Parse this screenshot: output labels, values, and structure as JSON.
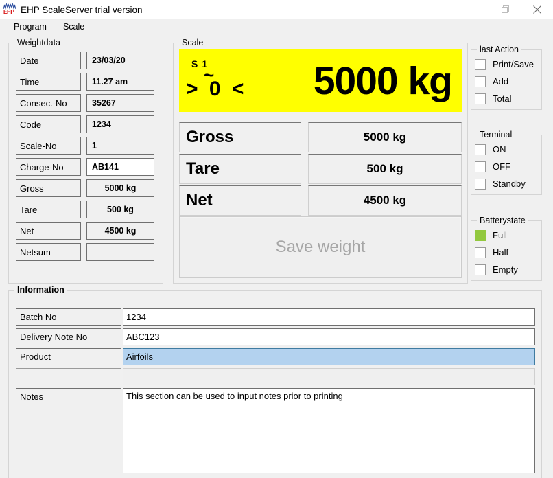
{
  "window": {
    "title": "EHP ScaleServer trial version",
    "icon_name": "ehp-logo-icon",
    "icon_text": "EHP",
    "minimize_label": "Minimize",
    "maximize_label": "Maximize",
    "close_label": "Close"
  },
  "menubar": {
    "items": [
      {
        "label": "Program"
      },
      {
        "label": "Scale"
      }
    ]
  },
  "weightdata": {
    "legend": "Weightdata",
    "rows": [
      {
        "label": "Date",
        "value": "23/03/20",
        "style": "gray-left"
      },
      {
        "label": "Time",
        "value": "11.27 am",
        "style": "gray-left"
      },
      {
        "label": "Consec.-No",
        "value": "35267",
        "style": "gray-left"
      },
      {
        "label": "Code",
        "value": "1234",
        "style": "gray-left"
      },
      {
        "label": "Scale-No",
        "value": "1",
        "style": "gray-left"
      },
      {
        "label": "Charge-No",
        "value": "AB141",
        "style": "white-left"
      },
      {
        "label": "Gross",
        "value": "5000 kg",
        "style": "gray-center"
      },
      {
        "label": "Tare",
        "value": "500 kg",
        "style": "gray-center"
      },
      {
        "label": "Net",
        "value": "4500 kg",
        "style": "gray-center"
      },
      {
        "label": "Netsum",
        "value": "",
        "style": "gray-center"
      }
    ]
  },
  "scale": {
    "legend": "Scale",
    "display": {
      "scale_id": "S 1",
      "zero_indicator": "> 0 <",
      "zero_left": ">",
      "zero_value": "0",
      "zero_right": "<",
      "stability_mark": "~",
      "weight": "5000 kg",
      "background_color": "#ffff00"
    },
    "rows": [
      {
        "label": "Gross",
        "value": "5000 kg"
      },
      {
        "label": "Tare",
        "value": "500 kg"
      },
      {
        "label": "Net",
        "value": "4500 kg"
      }
    ],
    "save_button": {
      "label": "Save weight",
      "enabled": false
    }
  },
  "last_action": {
    "legend": "last Action",
    "items": [
      {
        "label": "Print/Save",
        "checked": false
      },
      {
        "label": "Add",
        "checked": false
      },
      {
        "label": "Total",
        "checked": false
      }
    ]
  },
  "terminal": {
    "legend": "Terminal",
    "items": [
      {
        "label": "ON",
        "checked": false
      },
      {
        "label": "OFF",
        "checked": false
      },
      {
        "label": "Standby",
        "checked": false
      }
    ]
  },
  "battery": {
    "legend": "Batterystate",
    "indicator_color": "#92c83e",
    "items": [
      {
        "label": "Full",
        "checked": true
      },
      {
        "label": "Half",
        "checked": false
      },
      {
        "label": "Empty",
        "checked": false
      }
    ]
  },
  "information": {
    "legend": "Information",
    "fields": [
      {
        "label": "Batch No",
        "value": "1234",
        "state": "normal"
      },
      {
        "label": "Delivery Note No",
        "value": "ABC123",
        "state": "normal"
      },
      {
        "label": "Product",
        "value": "Airfoils",
        "state": "focused"
      },
      {
        "label": "",
        "value": "",
        "state": "disabled"
      }
    ],
    "notes": {
      "label": "Notes",
      "value": "This section can be used to input notes prior to printing"
    }
  }
}
